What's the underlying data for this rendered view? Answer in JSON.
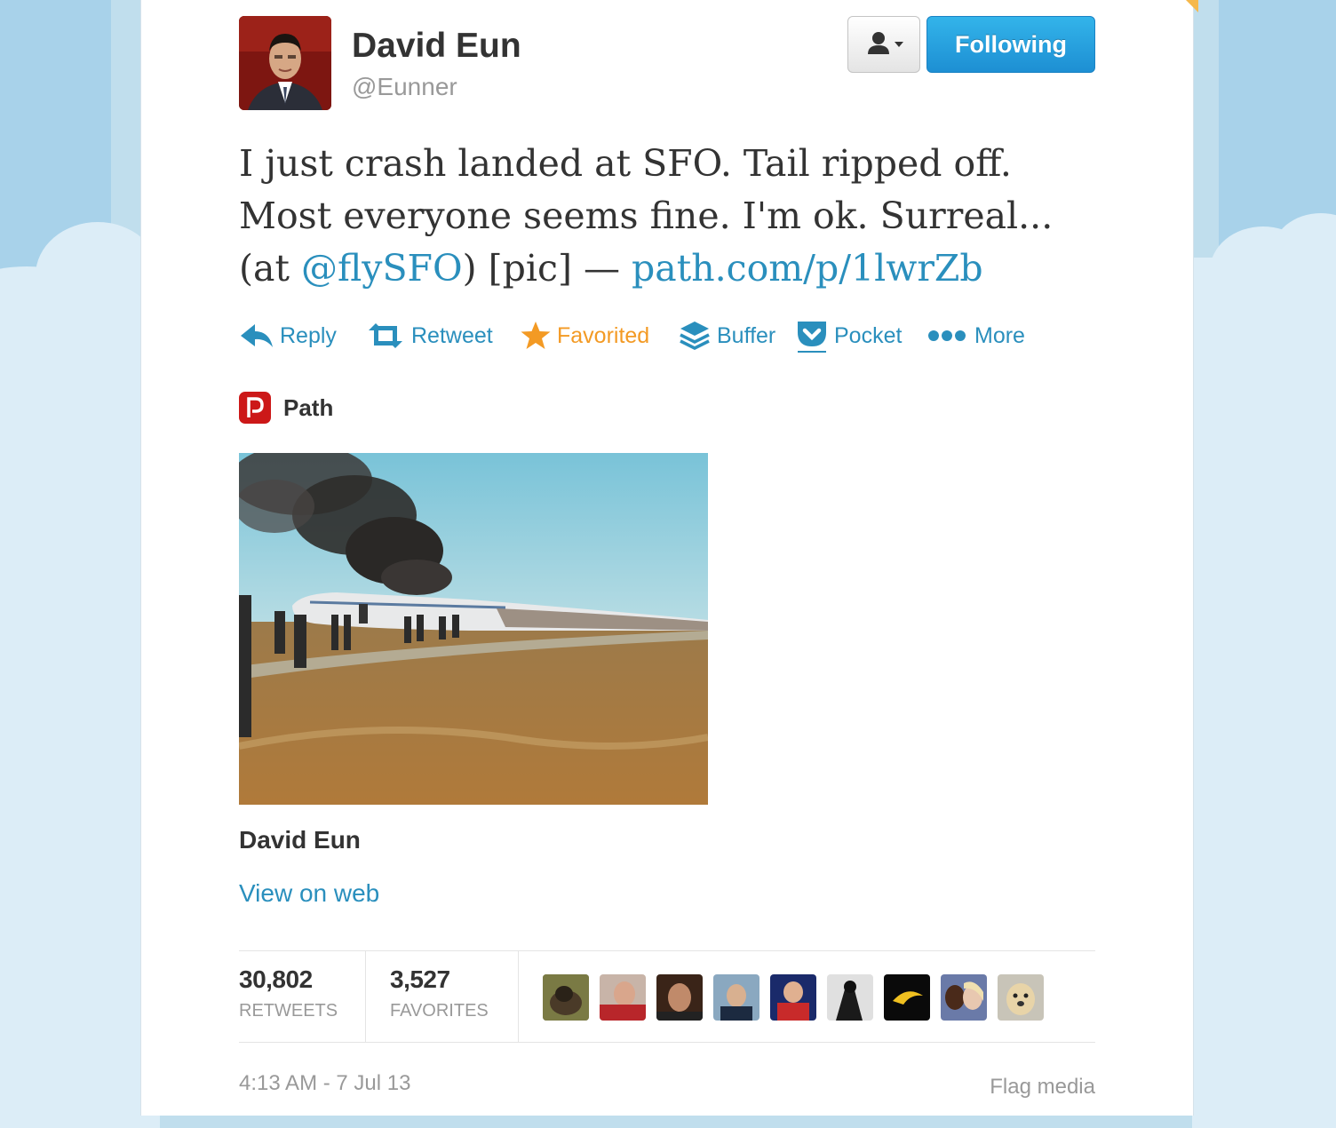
{
  "user": {
    "display_name": "David Eun",
    "screen_name": "@Eunner",
    "follow_button_label": "Following"
  },
  "tweet": {
    "text_line1": "I just crash landed at SFO. Tail ripped off.",
    "text_line2": "Most everyone seems fine. I'm ok. Surreal...",
    "text_line3_prefix": "(at ",
    "mention": "@flySFO",
    "text_line3_middle": ") [pic] — ",
    "url": "path.com/p/1lwrZb"
  },
  "actions": {
    "reply": "Reply",
    "retweet": "Retweet",
    "favorited": "Favorited",
    "buffer": "Buffer",
    "pocket": "Pocket",
    "more": "More"
  },
  "media": {
    "source_name": "Path",
    "author": "David Eun",
    "view_on_web": "View on web"
  },
  "stats": {
    "retweets_count": "30,802",
    "retweets_label": "RETWEETS",
    "favorites_count": "3,527",
    "favorites_label": "FAVORITES"
  },
  "footer": {
    "timestamp": "4:13 AM - 7 Jul 13",
    "flag_media": "Flag media"
  },
  "colors": {
    "link": "#2a8fbd",
    "favorited": "#f39a24",
    "follow_button": "#1d8fd3",
    "background_sky": "#c0deed"
  },
  "icons": [
    "reply-icon",
    "retweet-icon",
    "star-icon",
    "buffer-icon",
    "pocket-icon",
    "more-dots-icon",
    "user-dropdown-icon",
    "path-logo-icon"
  ]
}
